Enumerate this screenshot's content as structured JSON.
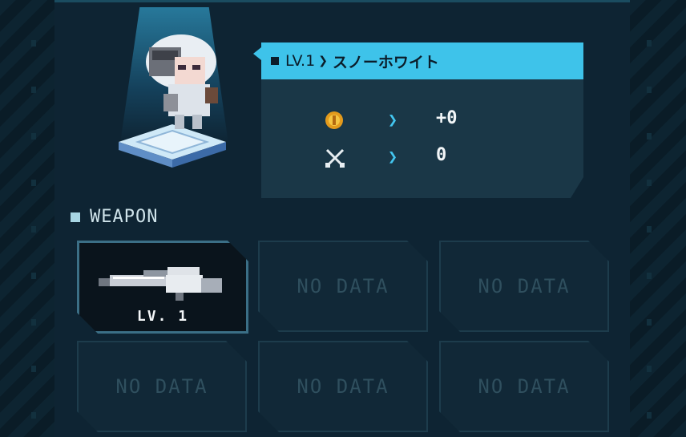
{
  "character": {
    "level_label": "LV.1",
    "name": "スノーホワイト",
    "stats": [
      {
        "icon": "coin-icon",
        "value": "+0"
      },
      {
        "icon": "crossed-swords-icon",
        "value": "0"
      }
    ]
  },
  "weapons": {
    "title": "WEAPON",
    "slots": [
      {
        "state": "equipped",
        "level": "LV. 1",
        "icon": "rifle-icon"
      },
      {
        "state": "empty",
        "label": "NO DATA"
      },
      {
        "state": "empty",
        "label": "NO DATA"
      },
      {
        "state": "empty",
        "label": "NO DATA"
      },
      {
        "state": "empty",
        "label": "NO DATA"
      },
      {
        "state": "empty",
        "label": "NO DATA"
      }
    ]
  },
  "colors": {
    "accent": "#3ec3ea",
    "panel": "#0e2433",
    "card": "#1a3747"
  }
}
